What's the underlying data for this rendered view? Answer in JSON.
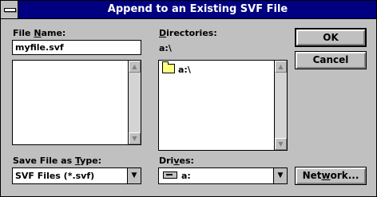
{
  "window": {
    "title": "Append to an Existing SVF File"
  },
  "file_name": {
    "label_pre": "File ",
    "label_hot": "N",
    "label_post": "ame:",
    "value": "myfile.svf"
  },
  "directories": {
    "label_hot": "D",
    "label_post": "irectories:",
    "current_path": "a:\\",
    "items": [
      "a:\\"
    ]
  },
  "save_type": {
    "label_pre": "Save File as ",
    "label_hot": "T",
    "label_post": "ype:",
    "value": "SVF Files (*.svf)"
  },
  "drives": {
    "label_pre": "Dri",
    "label_hot": "v",
    "label_post": "es:",
    "value": "a:"
  },
  "buttons": {
    "ok": "OK",
    "cancel": "Cancel",
    "network_pre": "Net",
    "network_hot": "w",
    "network_post": "ork..."
  },
  "glyphs": {
    "up": "▲",
    "down": "▼",
    "dropdown": "▼"
  }
}
